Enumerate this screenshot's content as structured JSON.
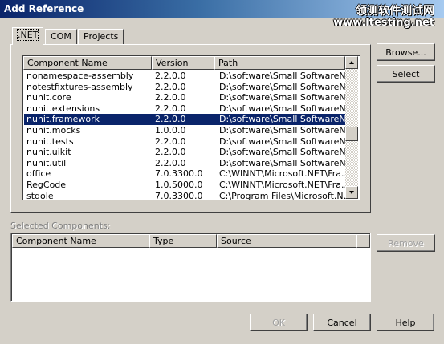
{
  "window": {
    "title": "Add Reference",
    "watermark_line1": "领测软件测试网",
    "watermark_line2": "www.ltesting.net"
  },
  "tabs": [
    {
      "label": ".NET",
      "active": true
    },
    {
      "label": "COM",
      "active": false
    },
    {
      "label": "Projects",
      "active": false
    }
  ],
  "components_list": {
    "columns": [
      "Component Name",
      "Version",
      "Path"
    ],
    "rows": [
      {
        "name": "nonamespace-assembly",
        "version": "2.2.0.0",
        "path": "D:\\software\\Small SoftwareN..."
      },
      {
        "name": "notestfixtures-assembly",
        "version": "2.2.0.0",
        "path": "D:\\software\\Small SoftwareN..."
      },
      {
        "name": "nunit.core",
        "version": "2.2.0.0",
        "path": "D:\\software\\Small SoftwareN..."
      },
      {
        "name": "nunit.extensions",
        "version": "2.2.0.0",
        "path": "D:\\software\\Small SoftwareN..."
      },
      {
        "name": "nunit.framework",
        "version": "2.2.0.0",
        "path": "D:\\software\\Small SoftwareN...",
        "selected": true
      },
      {
        "name": "nunit.mocks",
        "version": "1.0.0.0",
        "path": "D:\\software\\Small SoftwareN..."
      },
      {
        "name": "nunit.tests",
        "version": "2.2.0.0",
        "path": "D:\\software\\Small SoftwareN..."
      },
      {
        "name": "nunit.uikit",
        "version": "2.2.0.0",
        "path": "D:\\software\\Small SoftwareN..."
      },
      {
        "name": "nunit.util",
        "version": "2.2.0.0",
        "path": "D:\\software\\Small SoftwareN..."
      },
      {
        "name": "office",
        "version": "7.0.3300.0",
        "path": "C:\\WINNT\\Microsoft.NET\\Fra..."
      },
      {
        "name": "RegCode",
        "version": "1.0.5000.0",
        "path": "C:\\WINNT\\Microsoft.NET\\Fra..."
      },
      {
        "name": "stdole",
        "version": "7.0.3300.0",
        "path": "C:\\Program Files\\Microsoft.N..."
      }
    ]
  },
  "buttons": {
    "browse": "Browse...",
    "select": "Select",
    "remove": "Remove",
    "ok": "OK",
    "cancel": "Cancel",
    "help": "Help"
  },
  "selected_components": {
    "label": "Selected Components:",
    "columns": [
      "Component Name",
      "Type",
      "Source"
    ]
  },
  "colors": {
    "dialog_bg": "#d4d0c8",
    "title_bar": "#0a246a",
    "selection": "#0a246a"
  }
}
